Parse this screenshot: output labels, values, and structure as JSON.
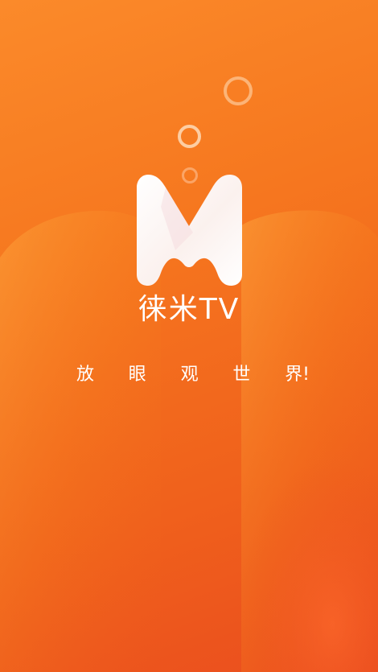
{
  "app": {
    "name": "徕米TV",
    "slogan_chars": [
      "放",
      "眼",
      "观",
      "世",
      "界!"
    ]
  },
  "colors": {
    "background_top": "#fb8a2a",
    "background_bottom": "#ea4d1e",
    "logo": "#ffffff",
    "text": "#ffffff"
  },
  "icons": {
    "logo": "m-letter-logo-icon",
    "bubbles": "bubble-ring-icon"
  }
}
